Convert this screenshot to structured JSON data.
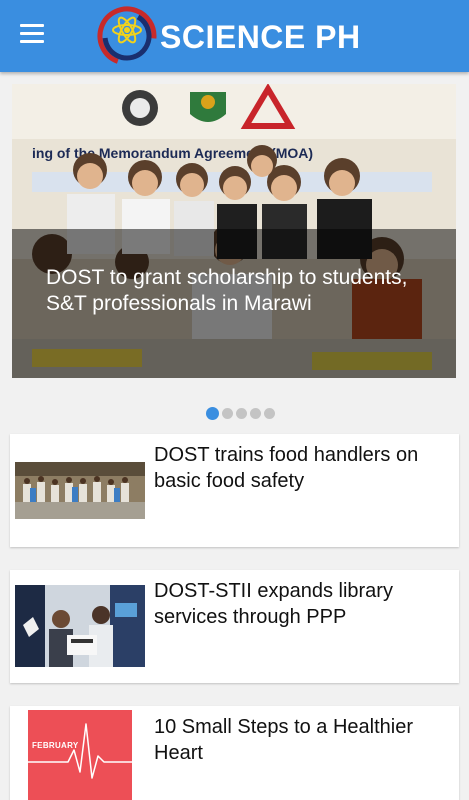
{
  "app": {
    "title": "SCIENCE PH",
    "brand_color": "#3a8ee0"
  },
  "icons": {
    "menu": "hamburger-menu-icon",
    "logo": "atom-logo-icon"
  },
  "slider": {
    "featured": {
      "title": "DOST to grant scholarship to students, S&T professionals in Marawi",
      "banner_text": "ing of the Memorandum   Agreement (MOA)"
    },
    "page_count": 5,
    "active_index": 0
  },
  "articles": [
    {
      "title": "DOST trains food handlers on basic food safety"
    },
    {
      "title": "DOST-STII expands library services through PPP"
    },
    {
      "title": "10 Small Steps to a Healthier Heart",
      "thumb_text": "FEBRUARY"
    }
  ]
}
